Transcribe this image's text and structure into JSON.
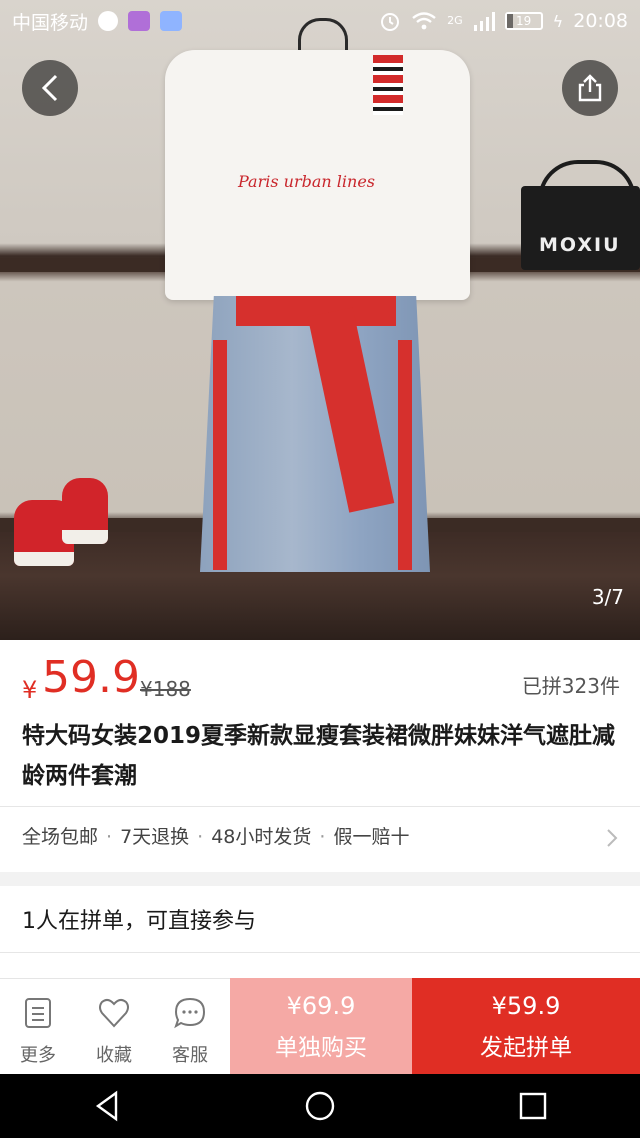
{
  "status_bar": {
    "carrier": "中国移动",
    "network": "2G",
    "battery": "19",
    "time": "20:08"
  },
  "hero": {
    "counter": "3/7",
    "bag_brand": "MOXIU",
    "shirt_script": "Paris urban lines"
  },
  "product": {
    "currency": "¥",
    "price": "59.9",
    "original_price": "¥188",
    "sold": "已拼323件",
    "title": "特大码女装2019夏季新款显瘦套装裙微胖妹妹洋气遮肚减龄两件套潮"
  },
  "services": [
    "全场包邮",
    "7天退换",
    "48小时发货",
    "假一赔十"
  ],
  "services_separator": "·",
  "group": {
    "text": "1人在拼单，可直接参与"
  },
  "bottom_bar": {
    "more_label": "更多",
    "favorite_label": "收藏",
    "service_label": "客服",
    "alone_price": "¥69.9",
    "alone_label": "单独购买",
    "group_price": "¥59.9",
    "group_label": "发起拼单"
  },
  "colors": {
    "accent_red": "#e02e24",
    "light_red": "#f5a9a5"
  }
}
